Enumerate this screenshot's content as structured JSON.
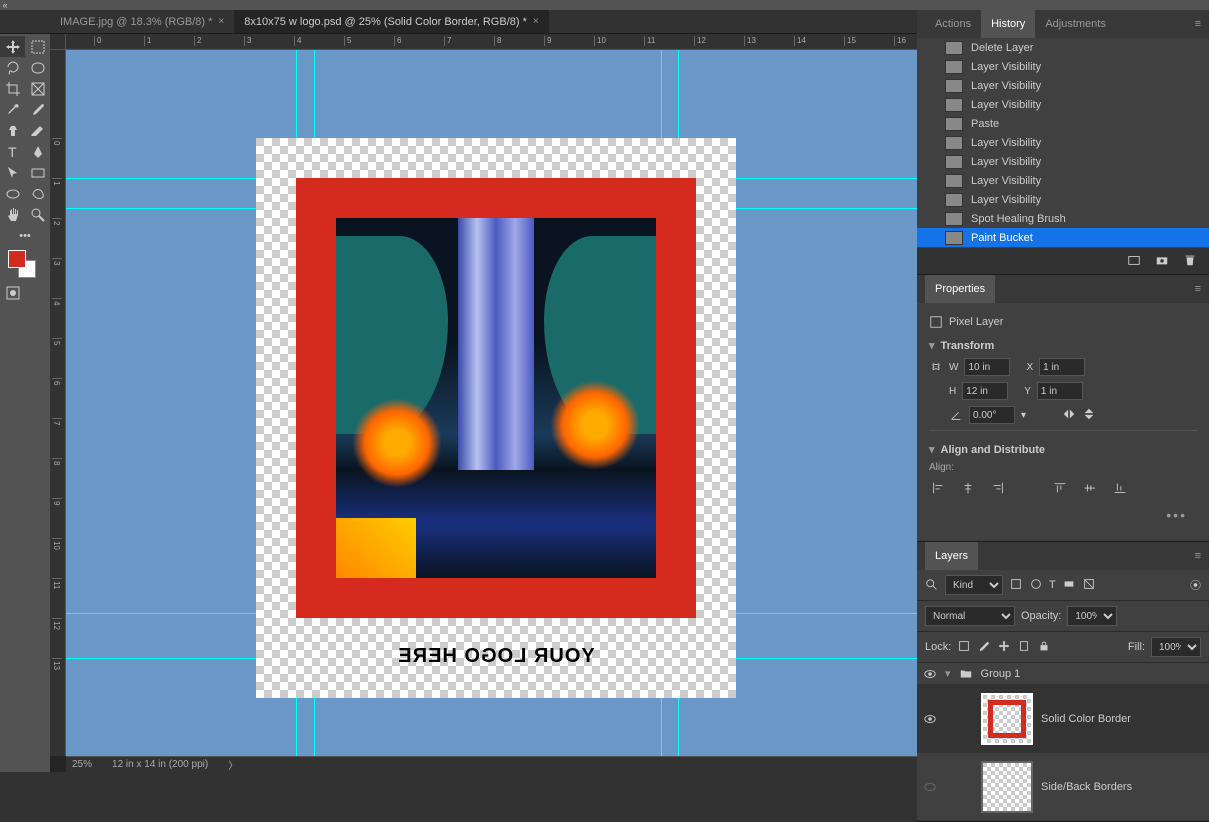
{
  "tabs": [
    {
      "label": "IMAGE.jpg @ 18.3% (RGB/8) *"
    },
    {
      "label": "8x10x75 w logo.psd @ 25% (Solid Color Border, RGB/8) *"
    }
  ],
  "canvas": {
    "logo_text": "YOUR LOGO HERE",
    "zoom": "25%",
    "doc_info": "12 in x 14 in (200 ppi)",
    "ruler_marks": [
      "0",
      "1",
      "2",
      "3",
      "4",
      "5",
      "6",
      "7",
      "8",
      "9",
      "10",
      "11",
      "12",
      "13",
      "14",
      "15",
      "16"
    ]
  },
  "panels": {
    "history": {
      "tabs": [
        "Actions",
        "History",
        "Adjustments"
      ],
      "items": [
        "Delete Layer",
        "Layer Visibility",
        "Layer Visibility",
        "Layer Visibility",
        "Paste",
        "Layer Visibility",
        "Layer Visibility",
        "Layer Visibility",
        "Layer Visibility",
        "Spot Healing Brush",
        "Paint Bucket"
      ]
    },
    "properties": {
      "title": "Properties",
      "type": "Pixel Layer",
      "transform": "Transform",
      "w": "10 in",
      "h": "12 in",
      "x": "1 in",
      "y": "1 in",
      "angle": "0.00°",
      "align_title": "Align and Distribute",
      "align_label": "Align:"
    },
    "layers": {
      "title": "Layers",
      "kind": "Kind",
      "blend": "Normal",
      "opacity_label": "Opacity:",
      "opacity": "100%",
      "lock_label": "Lock:",
      "fill_label": "Fill:",
      "fill": "100%",
      "group": "Group 1",
      "layer1": "Solid Color Border",
      "layer2": "Side/Back Borders"
    }
  }
}
